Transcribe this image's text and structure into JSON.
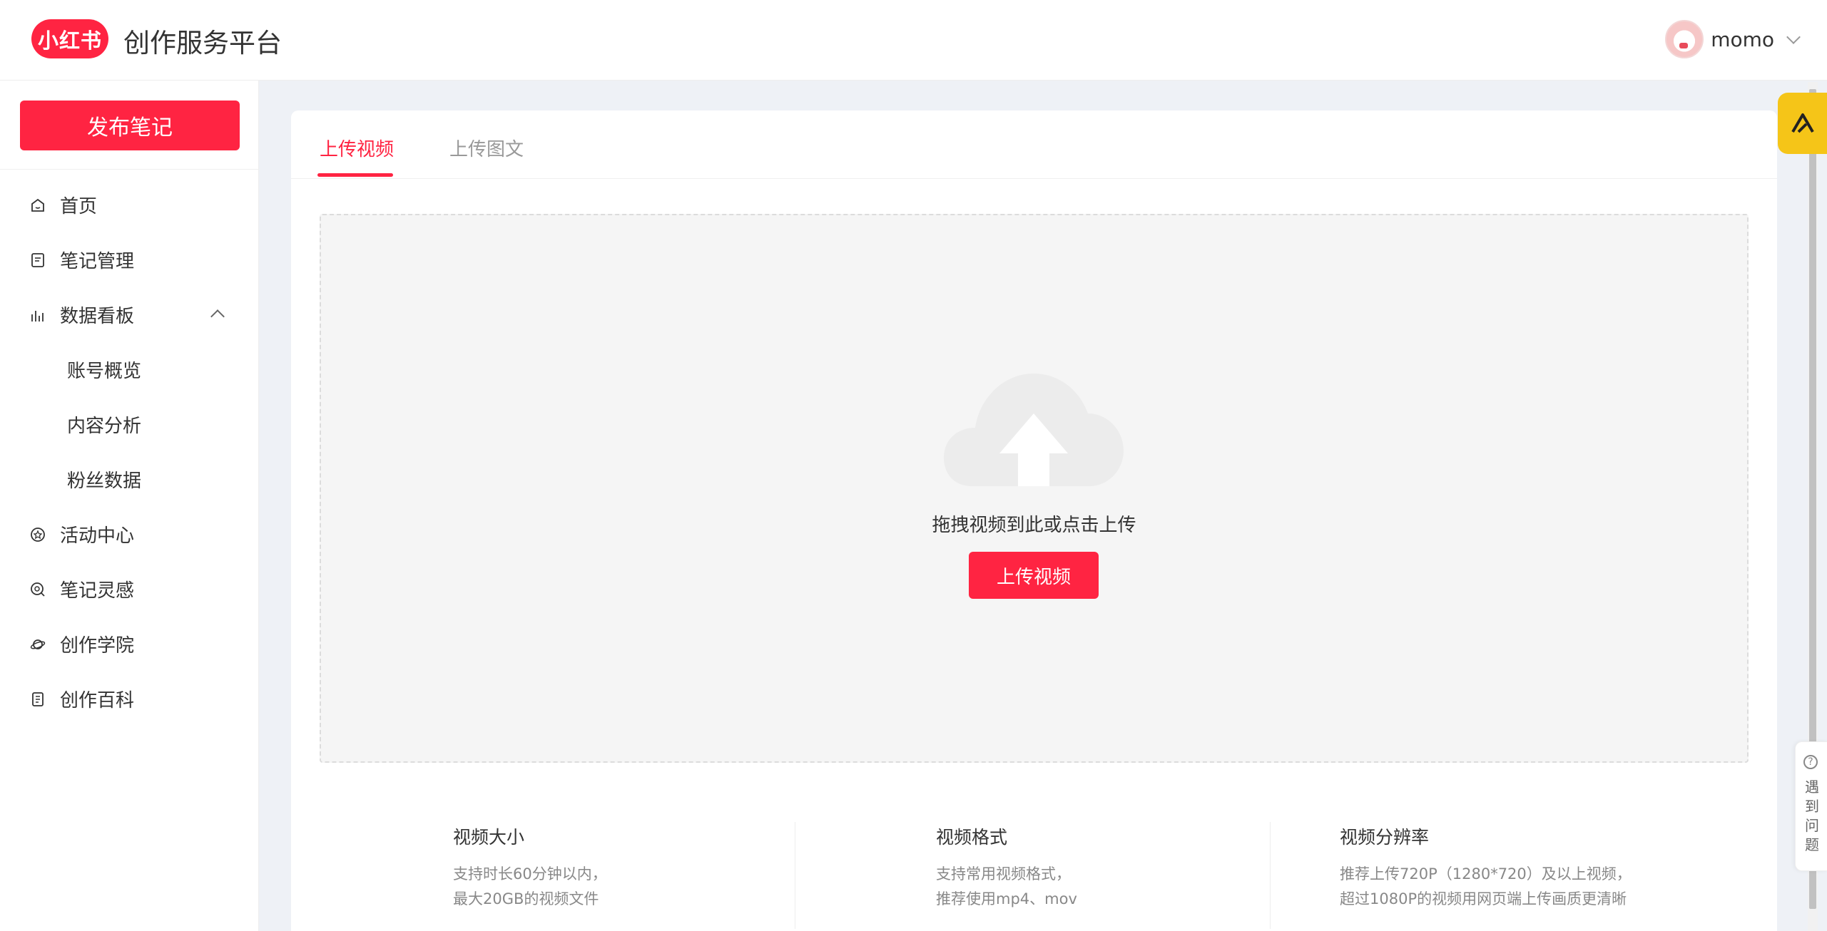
{
  "header": {
    "logo_text": "小红书",
    "title": "创作服务平台",
    "username": "momo"
  },
  "sidebar": {
    "publish_label": "发布笔记",
    "items": [
      {
        "label": "首页",
        "icon": "home-icon"
      },
      {
        "label": "笔记管理",
        "icon": "note-icon"
      },
      {
        "label": "数据看板",
        "icon": "bar-chart-icon",
        "expanded": true
      },
      {
        "label": "账号概览",
        "sub": true
      },
      {
        "label": "内容分析",
        "sub": true
      },
      {
        "label": "粉丝数据",
        "sub": true
      },
      {
        "label": "活动中心",
        "icon": "activity-icon"
      },
      {
        "label": "笔记灵感",
        "icon": "inspiration-icon"
      },
      {
        "label": "创作学院",
        "icon": "planet-icon"
      },
      {
        "label": "创作百科",
        "icon": "encyclopedia-icon"
      }
    ]
  },
  "tabs": [
    {
      "label": "上传视频",
      "active": true
    },
    {
      "label": "上传图文",
      "active": false
    }
  ],
  "dropzone": {
    "text": "拖拽视频到此或点击上传",
    "button_label": "上传视频"
  },
  "info": [
    {
      "title": "视频大小",
      "lines": [
        "支持时长60分钟以内，",
        "最大20GB的视频文件"
      ]
    },
    {
      "title": "视频格式",
      "lines": [
        "支持常用视频格式，",
        "推荐使用mp4、mov"
      ]
    },
    {
      "title": "视频分辨率",
      "lines": [
        "推荐上传720P（1280*720）及以上视频，",
        "超过1080P的视频用网页端上传画质更清晰"
      ]
    }
  ],
  "help": {
    "label": "遇到问题"
  },
  "colors": {
    "accent": "#ff2442",
    "float_button": "#f5c518"
  }
}
